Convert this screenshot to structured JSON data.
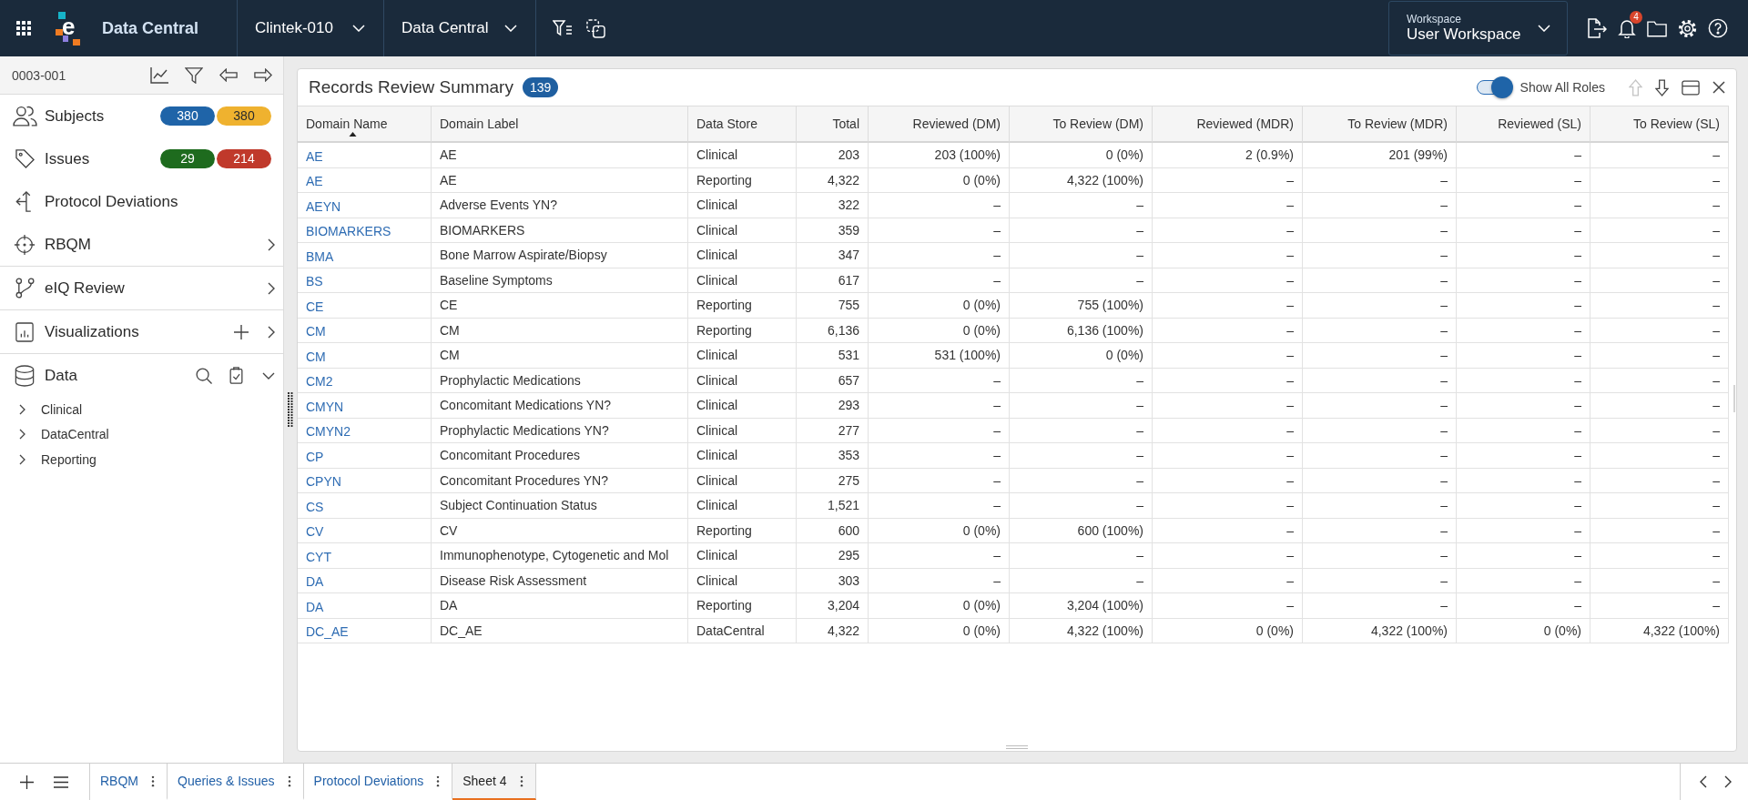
{
  "top_bar": {
    "logo_letter": "e",
    "app_title": "Data Central",
    "study": "Clintek-010",
    "module": "Data Central",
    "workspace": {
      "label": "Workspace",
      "value": "User Workspace"
    },
    "notification_count": "4"
  },
  "sidebar": {
    "record": "0003-001",
    "groups": [
      [
        {
          "label": "Subjects",
          "badges": [
            {
              "text": "380",
              "color": "#1f64a8"
            },
            {
              "text": "380",
              "color": "#efb22f"
            }
          ]
        },
        {
          "label": "Issues",
          "badges": [
            {
              "text": "29",
              "color": "#1e6b1e"
            },
            {
              "text": "214",
              "color": "#c0392b"
            }
          ]
        },
        {
          "label": "Protocol Deviations"
        },
        {
          "label": "RBQM",
          "expanded": false
        }
      ],
      [
        {
          "label": "eIQ Review",
          "expanded": false
        }
      ],
      [
        {
          "label": "Visualizations",
          "expanded": false
        }
      ],
      [
        {
          "label": "Data",
          "expanded": true,
          "children": [
            {
              "label": "Clinical",
              "expanded": false
            },
            {
              "label": "DataCentral",
              "expanded": false
            },
            {
              "label": "Reporting",
              "expanded": false
            }
          ]
        }
      ]
    ]
  },
  "card": {
    "title": "Records Review Summary",
    "count": "139",
    "show_all_roles": {
      "label": "Show All Roles",
      "on": true
    },
    "move_up": {
      "disabled": true
    },
    "move_down": {
      "disabled": false
    },
    "table": {
      "columns": [
        {
          "label": "Domain Name",
          "kind": "link",
          "sorted": true
        },
        {
          "label": "Domain Label",
          "kind": "text",
          "sorted": false
        },
        {
          "label": "Data Store",
          "kind": "text",
          "sorted": false
        },
        {
          "label": "Total",
          "kind": "number",
          "sorted": false
        },
        {
          "label": "Reviewed (DM)",
          "kind": "number",
          "sorted": false
        },
        {
          "label": "To Review (DM)",
          "kind": "number",
          "sorted": false
        },
        {
          "label": "Reviewed (MDR)",
          "kind": "number",
          "sorted": false
        },
        {
          "label": "To Review (MDR)",
          "kind": "number",
          "sorted": false
        },
        {
          "label": "Reviewed (SL)",
          "kind": "number",
          "sorted": false
        },
        {
          "label": "To Review (SL)",
          "kind": "number",
          "sorted": false
        }
      ],
      "rows": [
        [
          "AE",
          "AE",
          "Clinical",
          "203",
          "203 (100%)",
          "0 (0%)",
          "2 (0.9%)",
          "201 (99%)",
          "–",
          "–"
        ],
        [
          "AE",
          "AE",
          "Reporting",
          "4,322",
          "0 (0%)",
          "4,322 (100%)",
          "–",
          "–",
          "–",
          "–"
        ],
        [
          "AEYN",
          "Adverse Events YN?",
          "Clinical",
          "322",
          "–",
          "–",
          "–",
          "–",
          "–",
          "–"
        ],
        [
          "BIOMARKERS",
          "BIOMARKERS",
          "Clinical",
          "359",
          "–",
          "–",
          "–",
          "–",
          "–",
          "–"
        ],
        [
          "BMA",
          "Bone Marrow Aspirate/Biopsy",
          "Clinical",
          "347",
          "–",
          "–",
          "–",
          "–",
          "–",
          "–"
        ],
        [
          "BS",
          "Baseline Symptoms",
          "Clinical",
          "617",
          "–",
          "–",
          "–",
          "–",
          "–",
          "–"
        ],
        [
          "CE",
          "CE",
          "Reporting",
          "755",
          "0 (0%)",
          "755 (100%)",
          "–",
          "–",
          "–",
          "–"
        ],
        [
          "CM",
          "CM",
          "Reporting",
          "6,136",
          "0 (0%)",
          "6,136 (100%)",
          "–",
          "–",
          "–",
          "–"
        ],
        [
          "CM",
          "CM",
          "Clinical",
          "531",
          "531 (100%)",
          "0 (0%)",
          "–",
          "–",
          "–",
          "–"
        ],
        [
          "CM2",
          "Prophylactic Medications",
          "Clinical",
          "657",
          "–",
          "–",
          "–",
          "–",
          "–",
          "–"
        ],
        [
          "CMYN",
          "Concomitant Medications YN?",
          "Clinical",
          "293",
          "–",
          "–",
          "–",
          "–",
          "–",
          "–"
        ],
        [
          "CMYN2",
          "Prophylactic Medications YN?",
          "Clinical",
          "277",
          "–",
          "–",
          "–",
          "–",
          "–",
          "–"
        ],
        [
          "CP",
          "Concomitant Procedures",
          "Clinical",
          "353",
          "–",
          "–",
          "–",
          "–",
          "–",
          "–"
        ],
        [
          "CPYN",
          "Concomitant Procedures YN?",
          "Clinical",
          "275",
          "–",
          "–",
          "–",
          "–",
          "–",
          "–"
        ],
        [
          "CS",
          "Subject Continuation Status",
          "Clinical",
          "1,521",
          "–",
          "–",
          "–",
          "–",
          "–",
          "–"
        ],
        [
          "CV",
          "CV",
          "Reporting",
          "600",
          "0 (0%)",
          "600 (100%)",
          "–",
          "–",
          "–",
          "–"
        ],
        [
          "CYT",
          "Immunophenotype, Cytogenetic and Mol",
          "Clinical",
          "295",
          "–",
          "–",
          "–",
          "–",
          "–",
          "–"
        ],
        [
          "DA",
          "Disease Risk Assessment",
          "Clinical",
          "303",
          "–",
          "–",
          "–",
          "–",
          "–",
          "–"
        ],
        [
          "DA",
          "DA",
          "Reporting",
          "3,204",
          "0 (0%)",
          "3,204 (100%)",
          "–",
          "–",
          "–",
          "–"
        ],
        [
          "DC_AE",
          "DC_AE",
          "DataCentral",
          "4,322",
          "0 (0%)",
          "4,322 (100%)",
          "0 (0%)",
          "4,322 (100%)",
          "0 (0%)",
          "4,322 (100%)"
        ]
      ]
    }
  },
  "sheet_tabs": [
    {
      "label": "RBQM",
      "selected": false
    },
    {
      "label": "Queries & Issues",
      "selected": false
    },
    {
      "label": "Protocol Deviations",
      "selected": false
    },
    {
      "label": "Sheet 4",
      "selected": true
    }
  ]
}
